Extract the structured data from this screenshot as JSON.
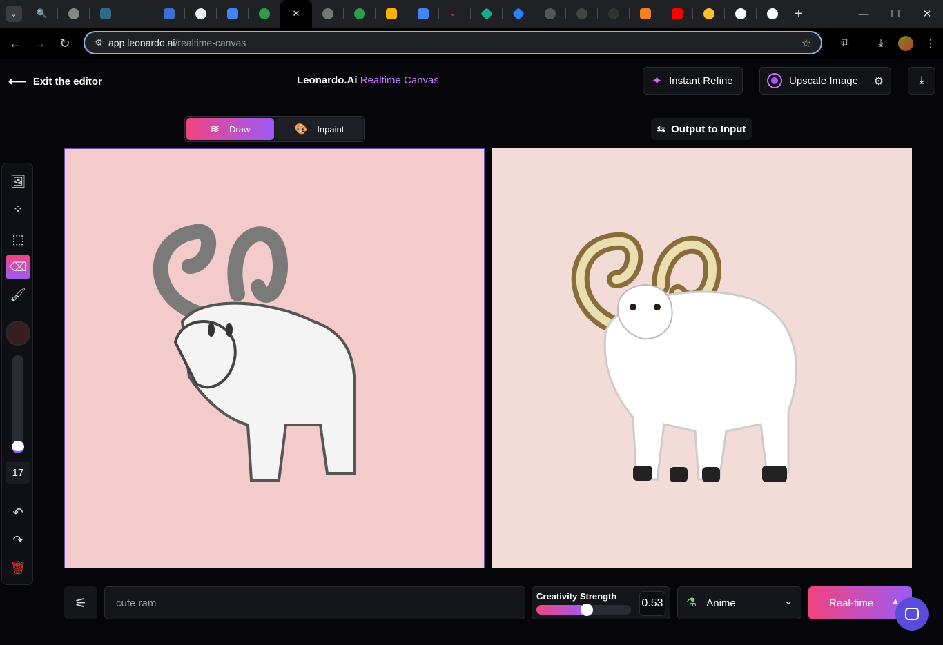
{
  "browser": {
    "url_host": "app.leonardo.ai",
    "url_path": "/realtime-canvas",
    "tab_favicons": [
      "search",
      "circle-gray",
      "eye-square",
      "blank",
      "puzzle",
      "openai",
      "translate",
      "green-plus",
      "close",
      "globe",
      "green-plus",
      "yellow-book",
      "docs",
      "red-arrow",
      "teal-diamond",
      "blue-diamond",
      "b-circle",
      "m-circle",
      "github",
      "stack",
      "youtube",
      "emoji",
      "google",
      "google"
    ],
    "active_tab_close": "✕",
    "new_tab": "+"
  },
  "header": {
    "exit_label": "Exit the editor",
    "title_main": "Leonardo.Ai",
    "title_accent": "Realtime Canvas",
    "refine_label": "Instant Refine",
    "upscale_label": "Upscale Image"
  },
  "modes": {
    "draw_label": "Draw",
    "inpaint_label": "Inpaint",
    "active": "draw"
  },
  "output_to_input_label": "Output to Input",
  "tools": {
    "brush_size": "17",
    "brush_color": "#3a1d1d"
  },
  "prompt": {
    "value": "cute ram"
  },
  "creativity": {
    "label": "Creativity Strength",
    "value": "0.53",
    "fraction": 0.53
  },
  "style": {
    "selected": "Anime"
  },
  "generate": {
    "label": "Real-time"
  },
  "colors": {
    "accent_pink": "#f0447f",
    "accent_purple": "#9b5bf5",
    "input_canvas_bg": "#f3cbcb",
    "output_canvas_bg": "#f3dcd8"
  }
}
